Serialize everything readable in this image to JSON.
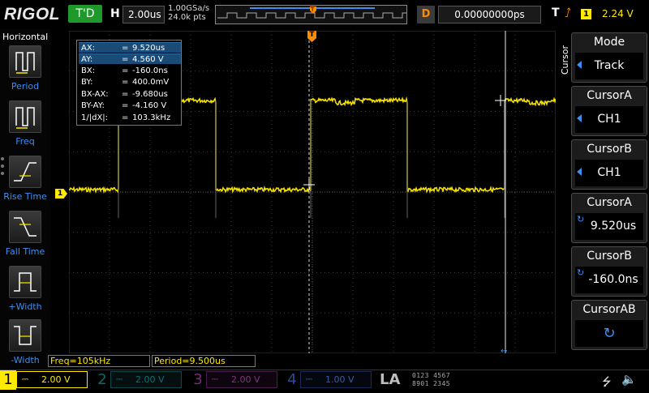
{
  "top": {
    "logo": "RIGOL",
    "run_state": "T'D",
    "h_letter": "H",
    "timebase": "2.00us",
    "sample_rate": "1.00GSa/s",
    "mem_depth": "24.0k pts",
    "d_letter": "D",
    "delay": "0.00000000ps",
    "t_letter": "T",
    "trigger_channel": "1",
    "trigger_level": "2.24 V",
    "trigger_marker": "T"
  },
  "left_menu": {
    "title": "Horizontal",
    "items": [
      {
        "label": "Period",
        "icon": "period-icon"
      },
      {
        "label": "Freq",
        "icon": "freq-icon"
      },
      {
        "label": "Rise Time",
        "icon": "rise-time-icon"
      },
      {
        "label": "Fall Time",
        "icon": "fall-time-icon"
      },
      {
        "label": "+Width",
        "icon": "positive-width-icon"
      },
      {
        "label": "-Width",
        "icon": "negative-width-icon"
      }
    ]
  },
  "cursor_info": {
    "rows": [
      {
        "k": "AX:",
        "v": "9.520us",
        "highlight": true
      },
      {
        "k": "AY:",
        "v": "4.560 V",
        "highlight": true
      },
      {
        "k": "BX:",
        "v": "-160.0ns",
        "highlight": false
      },
      {
        "k": "BY:",
        "v": "400.0mV",
        "highlight": false
      },
      {
        "k": "BX-AX:",
        "v": "-9.680us",
        "highlight": false
      },
      {
        "k": "BY-AY:",
        "v": "-4.160 V",
        "highlight": false
      },
      {
        "k": "1/|dX|:",
        "v": "103.3kHz",
        "highlight": false
      }
    ],
    "eq": "="
  },
  "measurements": {
    "freq": "Freq=105kHz",
    "period": "Period=9.500us"
  },
  "markers": {
    "ch1": "1"
  },
  "right_menu": {
    "vertical_title": "Cursor",
    "buttons": [
      {
        "title": "Mode",
        "value": "Track",
        "kind": "select"
      },
      {
        "title": "CursorA",
        "value": "CH1",
        "kind": "select"
      },
      {
        "title": "CursorB",
        "value": "CH1",
        "kind": "select"
      },
      {
        "title": "CursorA",
        "value": "9.520us",
        "kind": "knob"
      },
      {
        "title": "CursorB",
        "value": "-160.0ns",
        "kind": "knob"
      },
      {
        "title": "CursorAB",
        "value": "",
        "kind": "knob-only"
      }
    ]
  },
  "bottom": {
    "channels": [
      {
        "num": "1",
        "volts": "2.00 V",
        "color": "#ffea00",
        "active": true
      },
      {
        "num": "2",
        "volts": "2.00 V",
        "color": "#00c8c8",
        "active": false
      },
      {
        "num": "3",
        "volts": "2.00 V",
        "color": "#e040e0",
        "active": false
      },
      {
        "num": "4",
        "volts": "1.00 V",
        "color": "#2f6cff",
        "active": false
      }
    ],
    "la": "LA",
    "la_row1": "0123 4567",
    "la_row2": "8901 2345"
  },
  "colors": {
    "ch1": "#ffea00",
    "accent": "#3d8ef0",
    "trigger": "#ff8c00"
  }
}
